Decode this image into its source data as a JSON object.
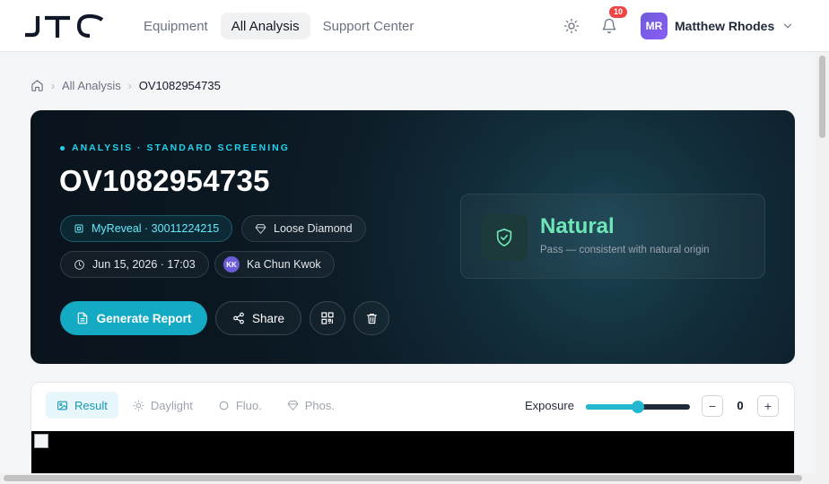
{
  "brand": {
    "logo_text": "JTC"
  },
  "nav": {
    "items": [
      {
        "label": "Equipment",
        "active": false
      },
      {
        "label": "All Analysis",
        "active": true
      },
      {
        "label": "Support Center",
        "active": false
      }
    ],
    "theme_icon": "sun-icon",
    "notifications": {
      "icon": "bell-icon",
      "count": "10"
    }
  },
  "user": {
    "initials": "MR",
    "name": "Matthew Rhodes"
  },
  "breadcrumb": {
    "home_icon": "home-icon",
    "parent": "All Analysis",
    "current": "OV1082954735"
  },
  "hero": {
    "eyebrow": "ANALYSIS · STANDARD SCREENING",
    "title": "OV1082954735",
    "device_chip": "MyReveal · 30011224215",
    "type_chip": "Loose Diamond",
    "datetime_chip": "Jun 15, 2026 · 17:03",
    "operator": {
      "initials": "KK",
      "name": "Ka Chun Kwok"
    },
    "generate_label": "Generate Report",
    "share_label": "Share"
  },
  "verdict": {
    "label": "Natural",
    "description": "Pass — consistent with natural origin",
    "color": "#6ee7b7"
  },
  "viewer": {
    "tabs": [
      {
        "label": "Result",
        "icon": "image-icon",
        "active": true
      },
      {
        "label": "Daylight",
        "icon": "sun-icon",
        "active": false
      },
      {
        "label": "Fluo.",
        "icon": "circle-icon",
        "active": false
      },
      {
        "label": "Phos.",
        "icon": "diamond-icon",
        "active": false
      }
    ],
    "exposure_label": "Exposure",
    "exposure_level_fraction": 0.5,
    "exposure_value": "0",
    "minus_label": "−",
    "plus_label": "+"
  },
  "colors": {
    "accent": "#15aac4",
    "hero_bg": "#0d1d28",
    "badge": "#ef4444"
  }
}
